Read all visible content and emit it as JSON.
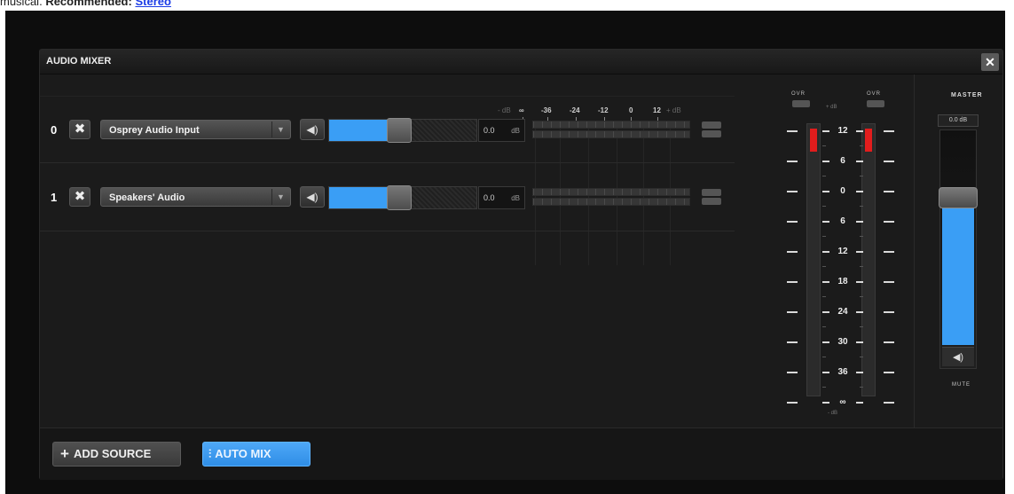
{
  "header_text": {
    "prefix": "musical.",
    "recommend": "Recommended:",
    "link": "Stereo"
  },
  "window": {
    "title": "AUDIO MIXER",
    "close": "✕"
  },
  "scale": {
    "left_unit": "- dB",
    "right_unit": "+ dB",
    "labels": [
      "∞",
      "-36",
      "-24",
      "-12",
      "0",
      "12"
    ]
  },
  "channels": [
    {
      "index": "0",
      "source": "Osprey Audio Input",
      "volume": 0.4,
      "db": "0.0",
      "db_unit": "dB"
    },
    {
      "index": "1",
      "source": "Speakers' Audio",
      "volume": 0.4,
      "db": "0.0",
      "db_unit": "dB"
    }
  ],
  "meter": {
    "ovr_left": "OVR",
    "ovr_right": "OVR",
    "plus_db": "+ dB",
    "minus_db": "- dB",
    "levels": [
      "12",
      "6",
      "0",
      "6",
      "12",
      "18",
      "24",
      "30",
      "36",
      "∞"
    ]
  },
  "master": {
    "title": "MASTER",
    "db": "0.0 dB",
    "level": 0.7,
    "mute_label": "MUTE"
  },
  "footer": {
    "add_source": "ADD SOURCE",
    "auto_mix": "AUTO MIX"
  },
  "icons": {
    "remove": "remove-x-icon",
    "speaker": "speaker-icon",
    "caret": "caret-down-icon",
    "plus": "plus-icon",
    "mix": "mixer-sliders-icon"
  },
  "colors": {
    "accent": "#3a9ef5",
    "clip": "#e21d1d",
    "background": "#1b1b1b"
  }
}
